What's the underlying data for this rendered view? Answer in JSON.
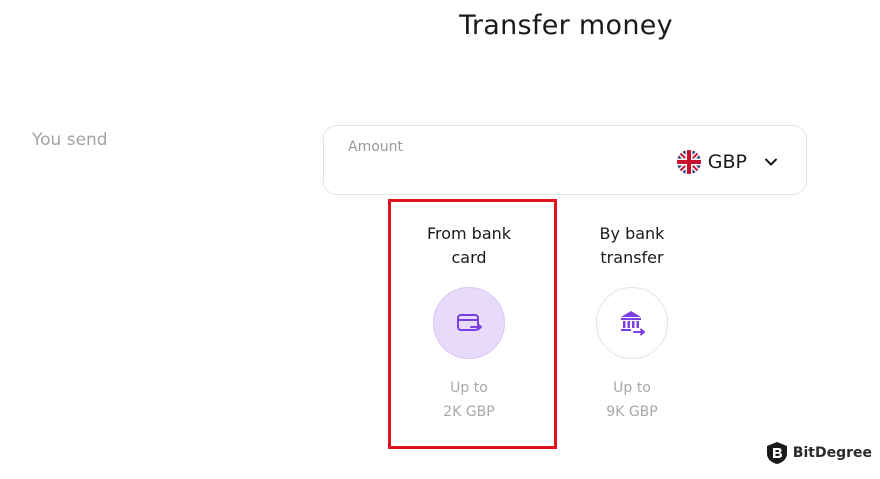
{
  "header": {
    "title": "Transfer money"
  },
  "send": {
    "label": "You send",
    "amount_label": "Amount",
    "currency": {
      "code": "GBP",
      "flag_icon": "uk-flag-icon",
      "chevron_icon": "chevron-down-icon"
    }
  },
  "methods": [
    {
      "title_line1": "From bank",
      "title_line2": "card",
      "icon": "bank-card-icon",
      "limit_line1": "Up to",
      "limit_line2": "2K GBP",
      "selected": true
    },
    {
      "title_line1": "By bank",
      "title_line2": "transfer",
      "icon": "bank-building-icon",
      "limit_line1": "Up to",
      "limit_line2": "9K GBP",
      "selected": false
    }
  ],
  "annotation": {
    "highlight_color": "#e0141f"
  },
  "colors": {
    "accent": "#7a3fe4",
    "selected_bg": "#e7dafa"
  },
  "watermark": {
    "logo_icon": "bitdegree-logo-icon",
    "text": "BitDegree"
  }
}
